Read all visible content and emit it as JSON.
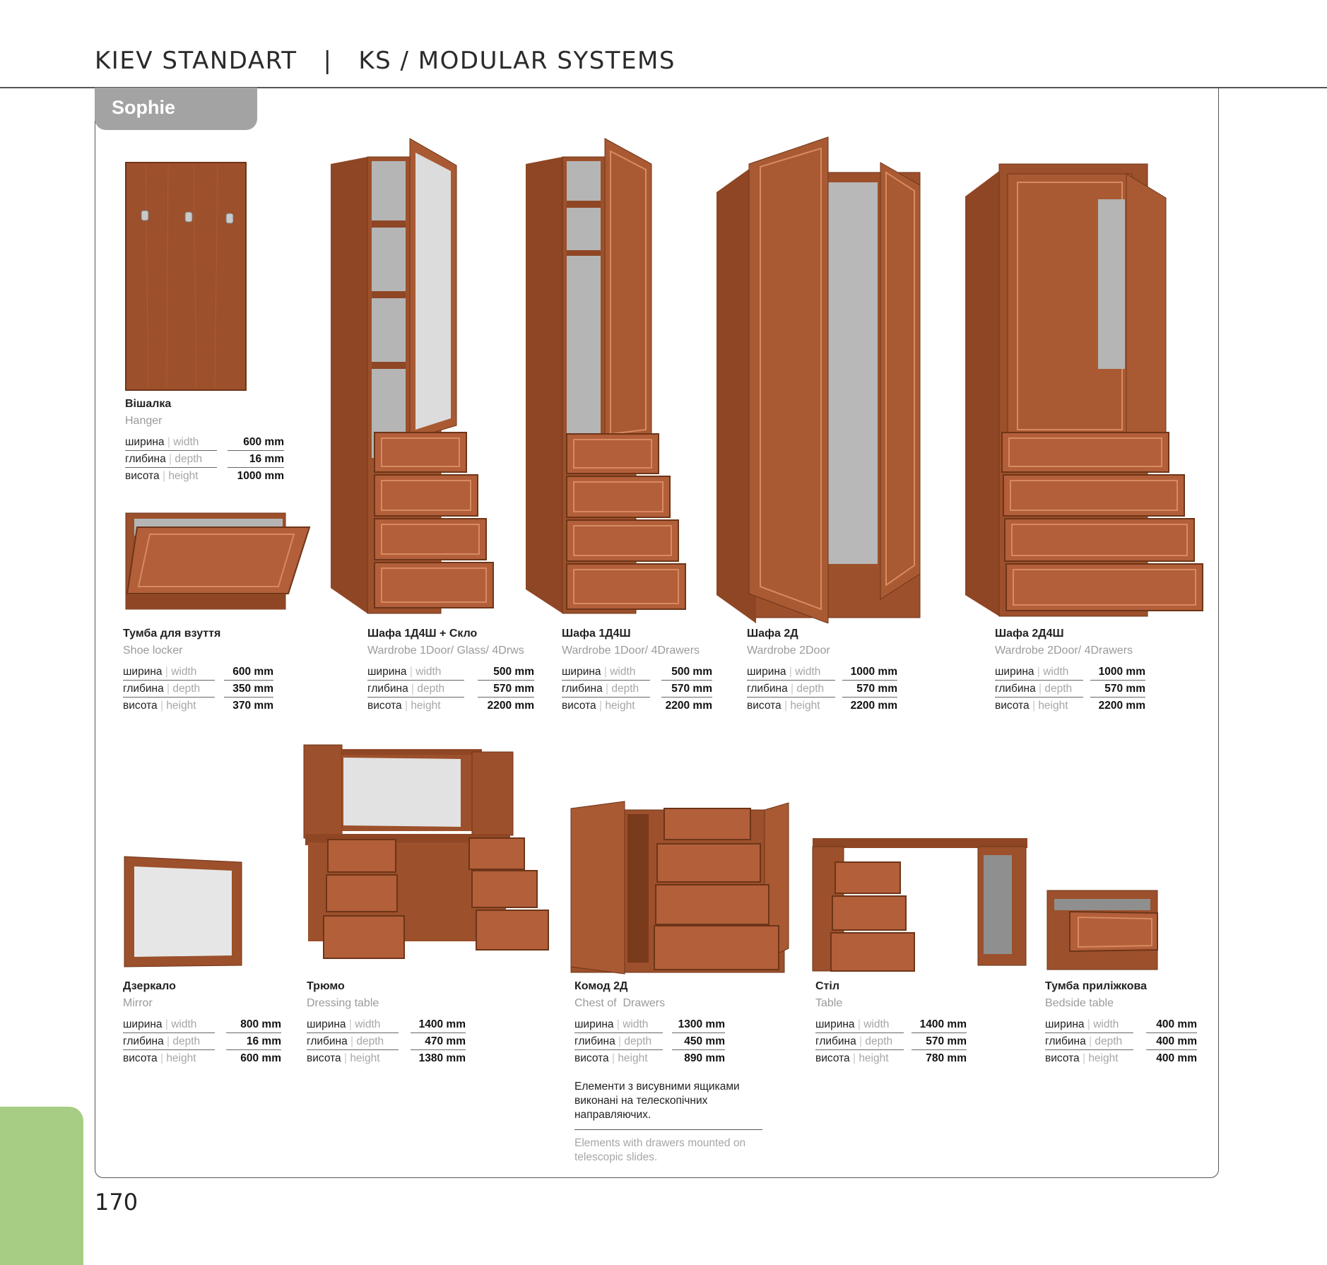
{
  "header": {
    "title": "KIEV STANDART   |   KS / MODULAR SYSTEMS"
  },
  "section_tab": "Sophie",
  "page_number": "170",
  "products": [
    {
      "name_ua": "Вішалка",
      "name_en": "Hanger",
      "width": "600 mm",
      "depth": "16 mm",
      "height": "1000 mm"
    },
    {
      "name_ua": "Тумба для взуття",
      "name_en": "Shoe locker",
      "width": "600 mm",
      "depth": "350 mm",
      "height": "370 mm"
    },
    {
      "name_ua": "Шафа 1Д4Ш + Скло",
      "name_en": "Wardrobe 1Door/ Glass/ 4Drws",
      "width": "500 mm",
      "depth": "570 mm",
      "height": "2200 mm"
    },
    {
      "name_ua": "Шафа 1Д4Ш",
      "name_en": "Wardrobe 1Door/ 4Drawers",
      "width": "500 mm",
      "depth": "570 mm",
      "height": "2200 mm"
    },
    {
      "name_ua": "Шафа 2Д",
      "name_en": "Wardrobe 2Door",
      "width": "1000 mm",
      "depth": "570 mm",
      "height": "2200 mm"
    },
    {
      "name_ua": "Шафа 2Д4Ш",
      "name_en": "Wardrobe 2Door/ 4Drawers",
      "width": "1000 mm",
      "depth": "570 mm",
      "height": "2200 mm"
    },
    {
      "name_ua": "Дзеркало",
      "name_en": "Mirror",
      "width": "800 mm",
      "depth": "16 mm",
      "height": "600 mm"
    },
    {
      "name_ua": "Трюмо",
      "name_en": "Dressing table",
      "width": "1400 mm",
      "depth": "470 mm",
      "height": "1380 mm"
    },
    {
      "name_ua": "Комод 2Д",
      "name_en": "Chest of  Drawers",
      "width": "1300 mm",
      "depth": "450 mm",
      "height": "890 mm"
    },
    {
      "name_ua": "Стіл",
      "name_en": "Table",
      "width": "1400 mm",
      "depth": "570 mm",
      "height": "780 mm"
    },
    {
      "name_ua": "Тумба приліжкова",
      "name_en": "Bedside table",
      "width": "400 mm",
      "depth": "400 mm",
      "height": "400 mm"
    }
  ],
  "spec_labels": {
    "width_ua": "ширина",
    "width_en": "width",
    "depth_ua": "глибина",
    "depth_en": "depth",
    "height_ua": "висота",
    "height_en": "height",
    "separator": "|"
  },
  "note": {
    "ua": "Елементи з висувними ящиками виконані на телескопічних направляючих.",
    "en": "Elements with drawers mounted on telescopic slides."
  },
  "colors": {
    "wood": "#9a4f2b",
    "wood_dark": "#7a3a1c",
    "tab_gray": "#a3a3a3",
    "accent_green": "#a7cd84"
  }
}
